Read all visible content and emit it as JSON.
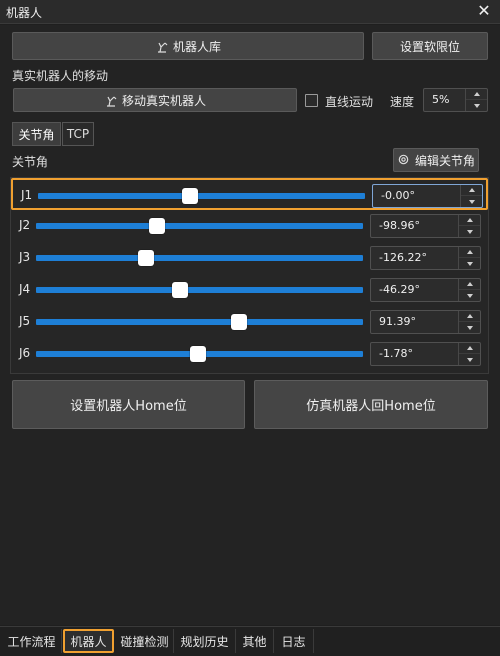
{
  "window": {
    "title": "机器人",
    "close_icon": "close-icon"
  },
  "toolbar": {
    "robot_library_label": "机器人库",
    "soft_limit_label": "设置软限位"
  },
  "real_robot": {
    "section_label": "真实机器人的移动",
    "move_button_label": "移动真实机器人",
    "linear_motion_label": "直线运动",
    "linear_motion_checked": false,
    "speed_label": "速度",
    "speed_value": "5%"
  },
  "tabs": [
    {
      "label": "关节角",
      "active": true
    },
    {
      "label": "TCP",
      "active": false
    }
  ],
  "joint_section": {
    "label": "关节角",
    "edit_button_label": "编辑关节角"
  },
  "joints": [
    {
      "name": "J1",
      "value": "-0.00°",
      "slider_fraction": 0.466,
      "selected": true
    },
    {
      "name": "J2",
      "value": "-98.96°",
      "slider_fraction": 0.37,
      "selected": false
    },
    {
      "name": "J3",
      "value": "-126.22°",
      "slider_fraction": 0.335,
      "selected": false
    },
    {
      "name": "J4",
      "value": "-46.29°",
      "slider_fraction": 0.44,
      "selected": false
    },
    {
      "name": "J5",
      "value": "91.39°",
      "slider_fraction": 0.62,
      "selected": false
    },
    {
      "name": "J6",
      "value": "-1.78°",
      "slider_fraction": 0.495,
      "selected": false
    }
  ],
  "actions": {
    "set_home_label": "设置机器人Home位",
    "sim_home_label": "仿真机器人回Home位"
  },
  "bottom_tabs": [
    {
      "label": "工作流程",
      "active": false
    },
    {
      "label": "机器人",
      "active": true
    },
    {
      "label": "碰撞检测",
      "active": false
    },
    {
      "label": "规划历史",
      "active": false
    },
    {
      "label": "其他",
      "active": false
    },
    {
      "label": "日志",
      "active": false
    }
  ],
  "colors": {
    "accent": "#f0a030",
    "slider": "#1e7fd6"
  }
}
